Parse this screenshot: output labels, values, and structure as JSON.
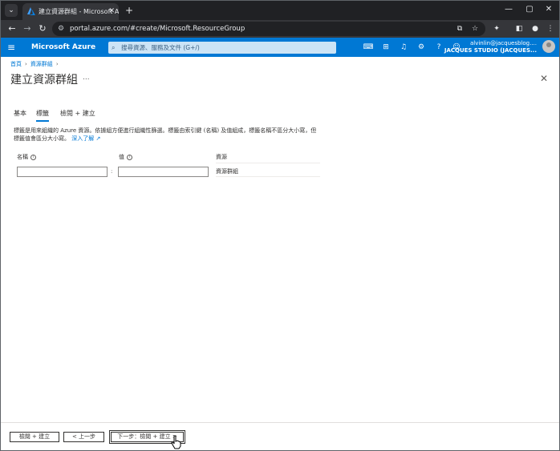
{
  "browser": {
    "tab_title": "建立資源群組 - Microsoft Azure",
    "tab_close": "✕",
    "new_tab": "+",
    "url": "portal.azure.com/#create/Microsoft.ResourceGroup",
    "window_buttons": {
      "minimize": "—",
      "maximize": "▢",
      "close": "✕"
    }
  },
  "azure_header": {
    "brand": "Microsoft Azure",
    "search_placeholder": "搜尋資源、服務及文件 (G+/)",
    "account_email": "alvinlin@jacquesblog....",
    "account_directory": "JACQUES STUDIO (JACQUES..."
  },
  "breadcrumb": {
    "home": "首頁",
    "resource_groups": "資源群組",
    "sep": "›"
  },
  "page": {
    "title": "建立資源群組",
    "more": "...",
    "close": "✕"
  },
  "tabs": [
    {
      "label": "基本",
      "active": false
    },
    {
      "label": "標籤",
      "active": true
    },
    {
      "label": "檢閱 + 建立",
      "active": false
    }
  ],
  "description": {
    "text": "標籤是用來組織的 Azure 資源。依據組方便進行組織性篩選。標籤由索引鍵 (名稱) 及值組成，標籤名稱不區分大小寫，但標籤值會區分大小寫。",
    "link": "深入了解 ↗"
  },
  "tag_grid": {
    "name_header": "名稱",
    "value_header": "值",
    "resource_header": "資源",
    "name_value": "",
    "value_value": "",
    "separator": ":",
    "resource_value": "資源群組"
  },
  "footer": {
    "review_create": "檢閱 + 建立",
    "previous": "< 上一步",
    "next": "下一步：檢閱 + 建立 >"
  }
}
